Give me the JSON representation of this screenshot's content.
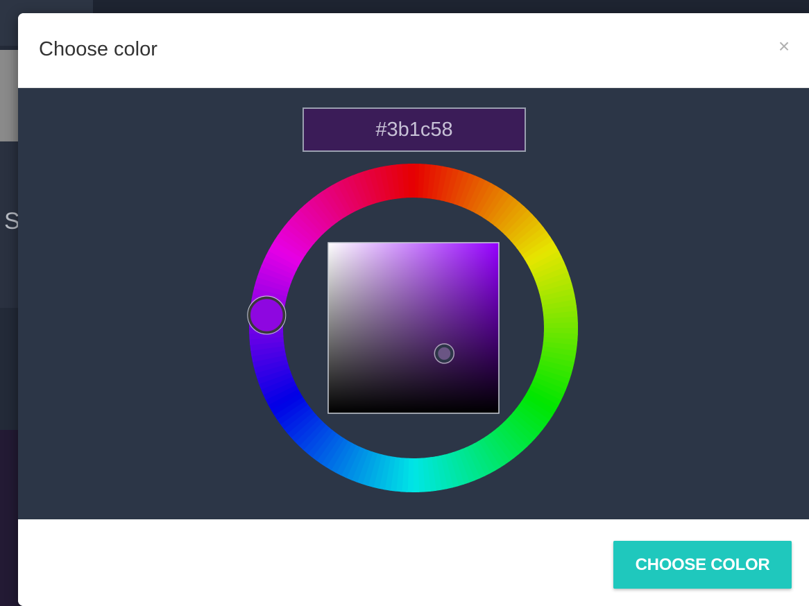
{
  "modal": {
    "title": "Choose color",
    "close_glyph": "×",
    "close_icon": "close-icon",
    "hex_value": "#3b1c58",
    "confirm_label": "CHOOSE COLOR"
  },
  "picker": {
    "hue_degrees": 275,
    "saturation_fraction": 0.68,
    "value_fraction": 0.35,
    "selected_color": "#3b1c58",
    "hue_swatch_color": "#8e07e0"
  },
  "background": {
    "partial_letter": "S"
  },
  "colors": {
    "accent": "#1fc8bd",
    "body_bg": "#2c3647"
  }
}
